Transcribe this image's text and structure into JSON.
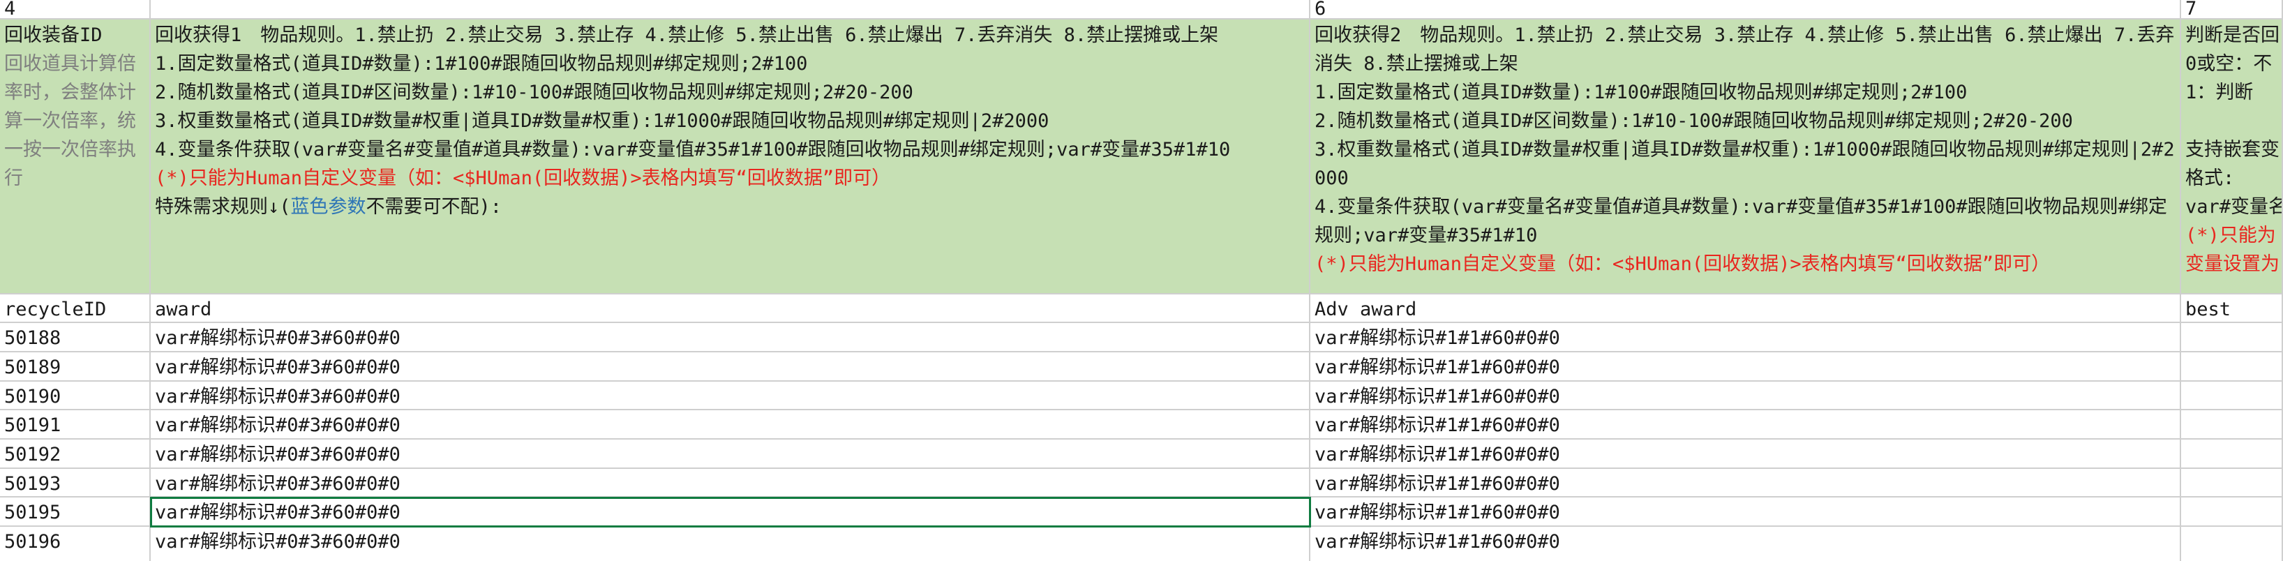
{
  "column_numbers": [
    "4",
    "",
    "6",
    "7"
  ],
  "header": {
    "col1_title": "回收装备ID",
    "col1_note": "回收道具计算倍率时，会整体计算一次倍率，统一按一次倍率执行",
    "col2_lines": [
      "回收获得1　物品规则。1.禁止扔 2.禁止交易 3.禁止存 4.禁止修 5.禁止出售 6.禁止爆出 7.丢弃消失 8.禁止摆摊或上架",
      "1.固定数量格式(道具ID#数量):1#100#跟随回收物品规则#绑定规则;2#100",
      "2.随机数量格式(道具ID#区间数量):1#10-100#跟随回收物品规则#绑定规则;2#20-200",
      "3.权重数量格式(道具ID#数量#权重|道具ID#数量#权重):1#1000#跟随回收物品规则#绑定规则|2#2000",
      "4.变量条件获取(var#变量名#变量值#道具#数量):var#变量值#35#1#100#跟随回收物品规则#绑定规则;var#变量#35#1#10"
    ],
    "col2_red": "(*)只能为Human自定义变量（如：<$HUman(回收数据)>表格内填写“回收数据”即可）",
    "col2_special_a": "特殊需求规则↓(",
    "col2_special_blue": "蓝色参数",
    "col2_special_b": "不需要可不配):",
    "col3_lines": [
      "回收获得2　物品规则。1.禁止扔 2.禁止交易 3.禁止存 4.禁止修 5.禁止出售 6.禁止爆出 7.丢弃消失 8.禁止摆摊或上架",
      "1.固定数量格式(道具ID#数量):1#100#跟随回收物品规则#绑定规则;2#100",
      "2.随机数量格式(道具ID#区间数量):1#10-100#跟随回收物品规则#绑定规则;2#20-200",
      "3.权重数量格式(道具ID#数量#权重|道具ID#数量#权重):1#1000#跟随回收物品规则#绑定规则|2#2000",
      "4.变量条件获取(var#变量名#变量值#道具#数量):var#变量值#35#1#100#跟随回收物品规则#绑定规则;var#变量#35#1#10"
    ],
    "col3_red": "(*)只能为Human自定义变量（如：<$HUman(回收数据)>表格内填写“回收数据”即可）",
    "col4_lines": [
      "判断是否回",
      "0或空：不",
      "1：判断",
      "",
      "支持嵌套变",
      "格式:",
      "var#变量名"
    ],
    "col4_red": [
      "(*)只能为",
      "变量设置为"
    ]
  },
  "field_names": [
    "recycleID",
    "award",
    "Adv award",
    "best"
  ],
  "rows": [
    {
      "id": "50188",
      "award": "var#解绑标识#0#3#60#0#0",
      "adv": "var#解绑标识#1#1#60#0#0"
    },
    {
      "id": "50189",
      "award": "var#解绑标识#0#3#60#0#0",
      "adv": "var#解绑标识#1#1#60#0#0"
    },
    {
      "id": "50190",
      "award": "var#解绑标识#0#3#60#0#0",
      "adv": "var#解绑标识#1#1#60#0#0"
    },
    {
      "id": "50191",
      "award": "var#解绑标识#0#3#60#0#0",
      "adv": "var#解绑标识#1#1#60#0#0"
    },
    {
      "id": "50192",
      "award": "var#解绑标识#0#3#60#0#0",
      "adv": "var#解绑标识#1#1#60#0#0"
    },
    {
      "id": "50193",
      "award": "var#解绑标识#0#3#60#0#0",
      "adv": "var#解绑标识#1#1#60#0#0"
    },
    {
      "id": "50195",
      "award": "var#解绑标识#0#3#60#0#0",
      "adv": "var#解绑标识#1#1#60#0#0"
    },
    {
      "id": "50196",
      "award": "var#解绑标识#0#3#60#0#0",
      "adv": "var#解绑标识#1#1#60#0#0"
    }
  ],
  "colors": {
    "header_fill": "#c6e0b4",
    "gridline": "#cfcfcf",
    "selection": "#107c41",
    "red_text": "#e8261f",
    "blue_text": "#2e75b6"
  }
}
